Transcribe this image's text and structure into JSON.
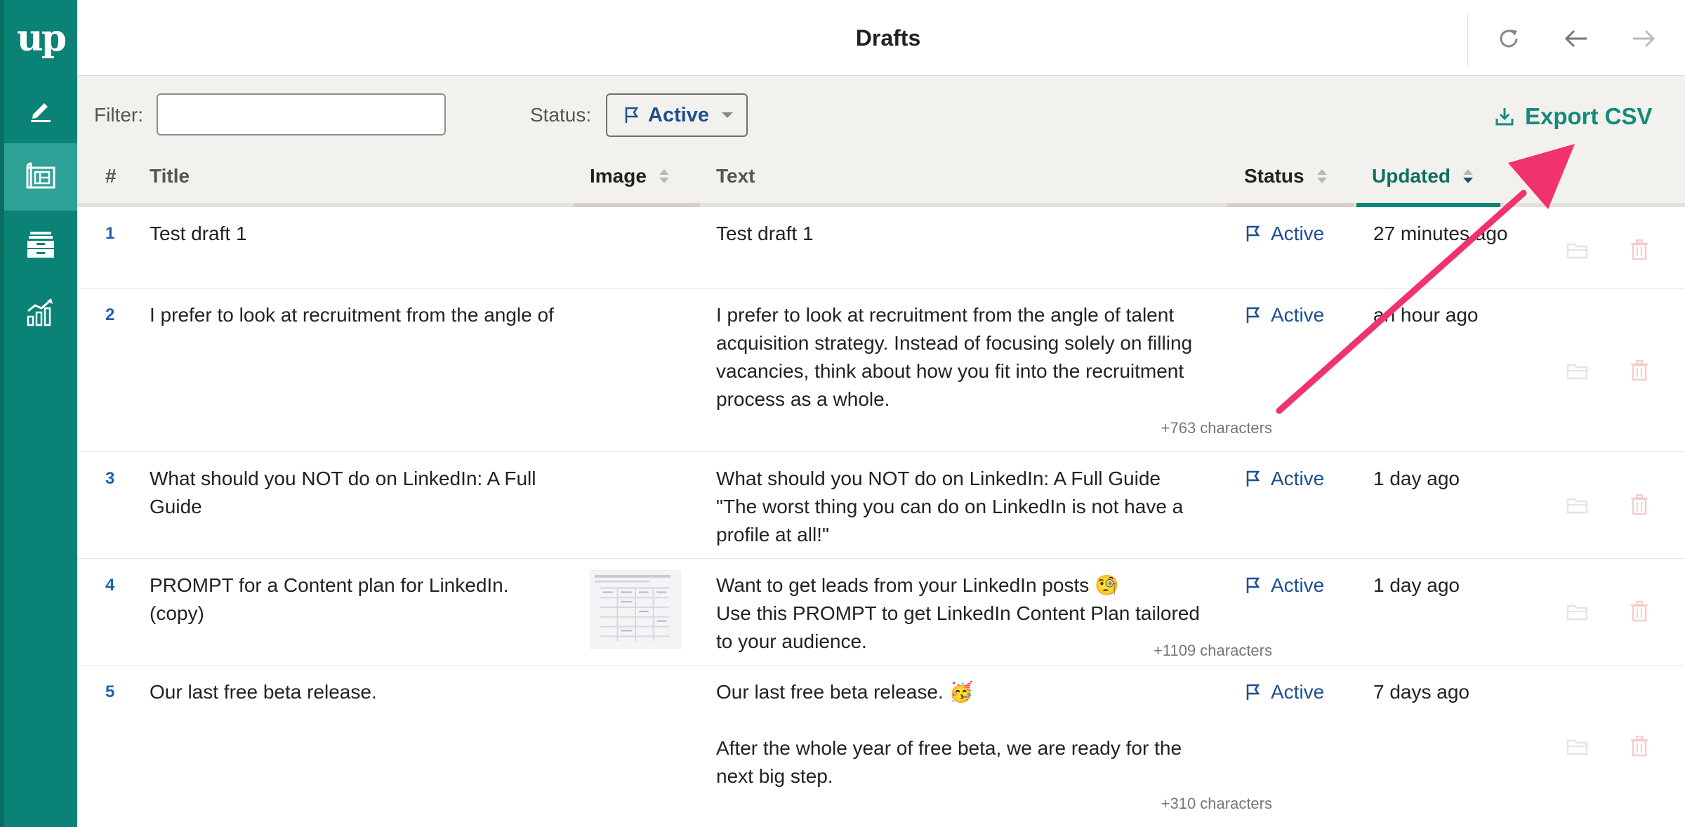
{
  "sidebar": {
    "logo_text": "up",
    "items": [
      {
        "name": "editor",
        "icon": "pen-icon"
      },
      {
        "name": "drafts",
        "icon": "blueprint-icon",
        "active": true
      },
      {
        "name": "archive",
        "icon": "archive-drawer-icon"
      },
      {
        "name": "analytics",
        "icon": "chart-icon"
      }
    ]
  },
  "header": {
    "title": "Drafts",
    "buttons": [
      "refresh-icon",
      "back-arrow-icon",
      "forward-arrow-icon"
    ]
  },
  "toolbar": {
    "filter_label": "Filter:",
    "filter_value": "",
    "status_label": "Status:",
    "status_value": "Active",
    "export_label": "Export CSV"
  },
  "table": {
    "columns": {
      "num": "#",
      "title": "Title",
      "image": "Image",
      "text": "Text",
      "status": "Status",
      "updated": "Updated"
    },
    "rows": [
      {
        "num": "1",
        "title": "Test draft 1",
        "text": "Test draft 1",
        "more": "",
        "status": "Active",
        "updated": "27 minutes ago"
      },
      {
        "num": "2",
        "title": "I prefer to look at recruitment from the angle of",
        "text": "I prefer to look at recruitment from the angle of talent acquisition strategy. Instead of focusing solely on filling vacancies, think about how you fit into the recruitment process as a whole.",
        "more": "+763 characters",
        "status": "Active",
        "updated": "an hour ago"
      },
      {
        "num": "3",
        "title": "What should you NOT do on LinkedIn: A Full Guide",
        "text": "What should you NOT do on LinkedIn: A Full Guide\n\"The worst thing you can do on LinkedIn is not have a profile at all!\"",
        "more": "",
        "status": "Active",
        "updated": "1 day ago"
      },
      {
        "num": "4",
        "title": "PROMPT for a Content plan for LinkedIn. (copy)",
        "text": "Want to get leads from your LinkedIn posts 🧐\nUse this PROMPT to get LinkedIn Content Plan tailored to your audience.",
        "more": "+1109 characters",
        "status": "Active",
        "updated": "1 day ago"
      },
      {
        "num": "5",
        "title": "Our last free beta release.",
        "text": "Our last free beta release. 🥳\n\nAfter the whole year of free beta, we are ready for the next big step.",
        "more": "+310 characters",
        "status": "Active",
        "updated": "7 days ago"
      }
    ]
  },
  "colors": {
    "sidebar": "#0a8276",
    "accent": "#138a7b",
    "link": "#1d4f90",
    "annotation": "#f0336e"
  }
}
